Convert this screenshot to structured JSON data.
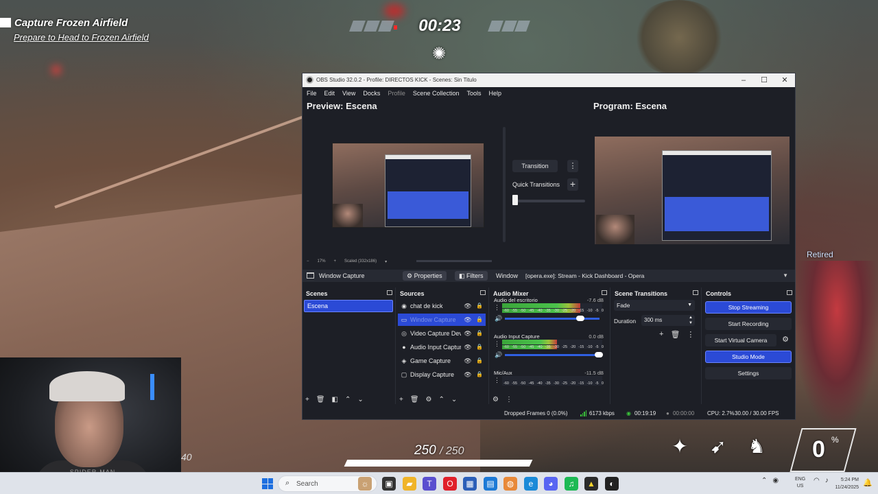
{
  "game": {
    "objective_title": "Capture Frozen Airfield",
    "objective_sub": "Prepare to Head to Frozen Airfield",
    "timer": "00:23",
    "retired_text": "Retired",
    "health_current": "250",
    "health_max": "/ 250",
    "health_fraction": 1.0,
    "ult_value": "0",
    "ult_pct": "%",
    "misc_number": "40"
  },
  "webcam": {
    "shirt_text": "SPIDER-MAN"
  },
  "obs": {
    "window_title": "OBS Studio 32.0.2 - Profile: DIRECTOS KICK - Scenes: Sin Titulo",
    "menu": [
      "File",
      "Edit",
      "View",
      "Docks",
      "Profile",
      "Scene Collection",
      "Tools",
      "Help"
    ],
    "preview_label": "Preview: Escena",
    "program_label": "Program: Escena",
    "preview_zoom": "17%",
    "preview_scale": "Scaled (332x186)",
    "transition_label": "Transition",
    "quick_transitions_label": "Quick Transitions",
    "source_bar": {
      "selected_source": "Window Capture",
      "properties_label": "Properties",
      "filters_label": "Filters",
      "window_label": "Window",
      "window_value": "[opera.exe]: Stream - Kick Dashboard - Opera"
    },
    "scenes": {
      "title": "Scenes",
      "items": [
        "Escena"
      ]
    },
    "sources": {
      "title": "Sources",
      "items": [
        {
          "label": "chat de kick",
          "icon": "browser-icon"
        },
        {
          "label": "Window Capture",
          "icon": "window-icon"
        },
        {
          "label": "Video Capture Device",
          "icon": "camera-icon"
        },
        {
          "label": "Audio Input Capture",
          "icon": "mic-icon"
        },
        {
          "label": "Game Capture",
          "icon": "gamepad-icon"
        },
        {
          "label": "Display Capture",
          "icon": "display-icon"
        }
      ]
    },
    "mixer": {
      "title": "Audio Mixer",
      "scale_labels": [
        "-60",
        "-55",
        "-50",
        "-45",
        "-40",
        "-35",
        "-30",
        "-25",
        "-20",
        "-15",
        "-10",
        "-5",
        "0"
      ],
      "channels": [
        {
          "name": "Audio del escritorio",
          "db": "-7.6 dB",
          "level": 0.78,
          "volume": 0.8
        },
        {
          "name": "Audio Input Capture",
          "db": "0.0 dB",
          "level": 0.55,
          "volume": 0.99
        },
        {
          "name": "Mic/Aux",
          "db": "-11.5 dB",
          "level": 0.0,
          "volume": 0.7
        }
      ]
    },
    "scene_transitions": {
      "title": "Scene Transitions",
      "selected": "Fade",
      "duration_label": "Duration",
      "duration_value": "300 ms"
    },
    "controls": {
      "title": "Controls",
      "stop_streaming": "Stop Streaming",
      "start_recording": "Start Recording",
      "start_virtual_camera": "Start Virtual Camera",
      "studio_mode": "Studio Mode",
      "settings": "Settings"
    },
    "status": {
      "dropped_frames": "Dropped Frames 0 (0.0%)",
      "bitrate": "6173 kbps",
      "stream_time": "00:19:19",
      "record_time": "00:00:00",
      "cpu": "CPU: 2.7%",
      "fps": "30.00 / 30.00 FPS"
    }
  },
  "taskbar": {
    "search_placeholder": "Search",
    "lang_top": "ENG",
    "lang_bottom": "US",
    "time": "5:24 PM",
    "date": "11/24/2025"
  },
  "colors": {
    "obs_bg": "#1d1f26",
    "accent_blue": "#2b4ad6",
    "meter_green": "#4bc24b",
    "taskbar_bg": "#dfe3ea"
  }
}
